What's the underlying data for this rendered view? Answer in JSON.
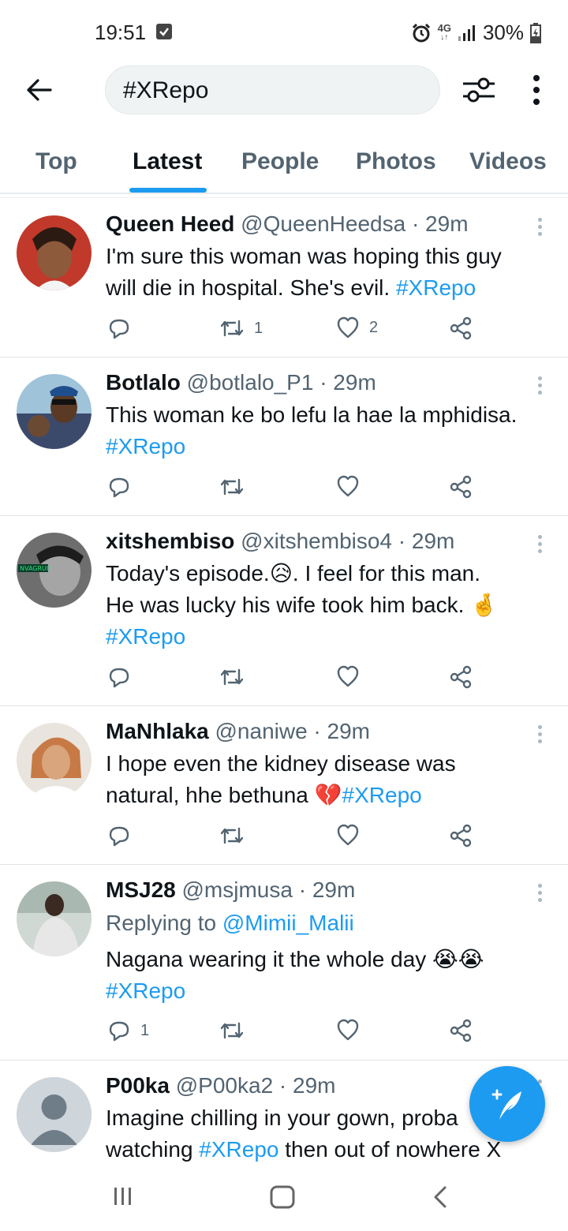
{
  "status_bar": {
    "time": "19:51",
    "network": "4G",
    "battery": "30%"
  },
  "search": {
    "query": "#XRepo"
  },
  "tabs": [
    {
      "label": "Top",
      "active": false
    },
    {
      "label": "Latest",
      "active": true
    },
    {
      "label": "People",
      "active": false
    },
    {
      "label": "Photos",
      "active": false
    },
    {
      "label": "Videos",
      "active": false
    }
  ],
  "tweets": [
    {
      "name": "Queen Heed",
      "meta": "@QueenHeedsa · 29m",
      "line1": "I'm sure this woman was hoping this guy",
      "line2": "will die in hospital.  She's evil. ",
      "hashtag": "#XRepo",
      "replies": "",
      "retweets": "1",
      "likes": "2"
    },
    {
      "name": "Botlalo",
      "meta": "@botlalo_P1 · 29m",
      "line1": "This woman ke bo lefu la hae la mphidisa.",
      "hashtag": "#XRepo",
      "replies": "",
      "retweets": "",
      "likes": ""
    },
    {
      "name": "xitshembiso",
      "meta": "@xitshembiso4 · 29m",
      "line1": "Today's episode.😥. I feel for this man.",
      "line2": "He was lucky his wife took him back. 🤞",
      "hashtag": "#XRepo",
      "replies": "",
      "retweets": "",
      "likes": ""
    },
    {
      "name": "MaNhlaka",
      "meta": "@naniwe · 29m",
      "line1": "I hope even the kidney disease was",
      "line2": "natural, hhe bethuna 💔",
      "hashtag": "#XRepo",
      "replies": "",
      "retweets": "",
      "likes": ""
    },
    {
      "name": "MSJ28",
      "meta": "@msjmusa · 29m",
      "replying_prefix": "Replying to ",
      "replying_handle": "@Mimii_Malii",
      "line1": "Nagana wearing it the whole day 😭😭",
      "hashtag": "#XRepo",
      "replies": "1",
      "retweets": "",
      "likes": ""
    },
    {
      "name": "P00ka",
      "meta": "@P00ka2 · 29m",
      "line1": "Imagine chilling in your gown, proba",
      "line2_prefix": "watching ",
      "hashtag": "#XRepo",
      "line2_suffix": " then out of nowhere X"
    }
  ],
  "colors": {
    "accent": "#1d9bf0",
    "text": "#0f1419",
    "muted": "#536471"
  }
}
